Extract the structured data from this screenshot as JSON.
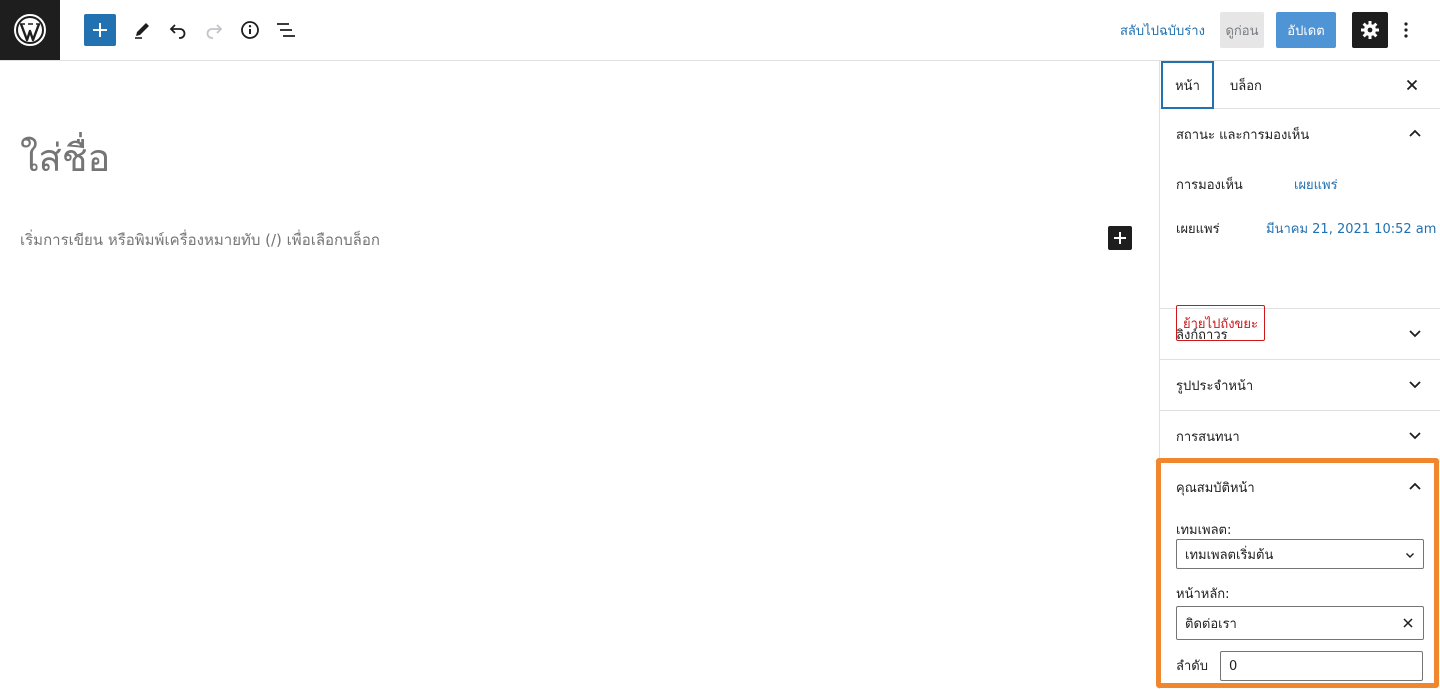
{
  "toolbar": {
    "switch_draft_label": "สลับไปฉบับร่าง",
    "preview_label": "ดูก่อน",
    "update_label": "อัปเดต"
  },
  "editor": {
    "title_placeholder": "ใส่ชื่อ",
    "block_placeholder": "เริ่มการเขียน หรือพิมพ์เครื่องหมายทับ (/) เพื่อเลือกบล็อก"
  },
  "sidebar": {
    "tabs": [
      {
        "label": "หน้า",
        "active": true
      },
      {
        "label": "บล็อก",
        "active": false
      }
    ],
    "status_panel": {
      "title": "สถานะ และการมองเห็น",
      "visibility_label": "การมองเห็น",
      "visibility_value": "เผยแพร่",
      "publish_label": "เผยแพร่",
      "publish_value": "มีนาคม 21, 2021 10:52 am",
      "trash_label": "ย้ายไปถังขยะ"
    },
    "permalink_panel": {
      "title": "ลิงก์ถาวร"
    },
    "featured_image_panel": {
      "title": "รูปประจำหน้า"
    },
    "discussion_panel": {
      "title": "การสนทนา"
    },
    "page_attributes_panel": {
      "title": "คุณสมบัติหน้า",
      "template_label": "เทมเพลต:",
      "template_value": "เทมเพลตเริ่มต้น",
      "parent_label": "หน้าหลัก:",
      "parent_value": "ติดต่อเรา",
      "order_label": "ลำดับ",
      "order_value": "0"
    }
  },
  "colors": {
    "accent": "#2271b1",
    "highlight": "#f0872f",
    "danger": "#cc1818"
  },
  "icons": [
    "wordpress-logo",
    "plus-icon",
    "pencil-icon",
    "undo-icon",
    "redo-icon",
    "info-icon",
    "list-view-icon",
    "gear-icon",
    "more-vertical-icon",
    "close-icon",
    "chevron-up-icon",
    "chevron-down-icon"
  ]
}
